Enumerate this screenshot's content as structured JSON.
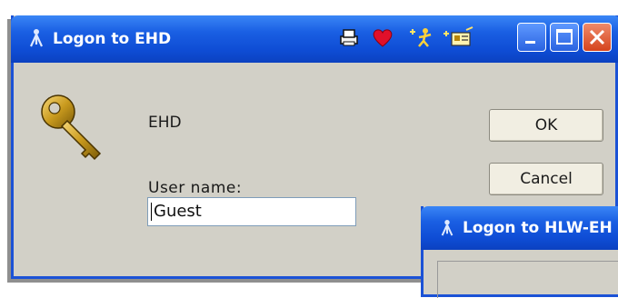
{
  "main_window": {
    "title": "Logon to EHD",
    "app_name": "EHD",
    "user_name_label": "User name:",
    "user_name_value": "Guest",
    "ok_label": "OK",
    "cancel_label": "Cancel",
    "toolbar_icons": [
      "printer-icon",
      "heart-icon",
      "person-sparkle-icon",
      "card-sparkle-icon"
    ],
    "window_buttons": [
      "minimize-icon",
      "maximize-icon",
      "close-icon"
    ]
  },
  "second_window": {
    "title": "Logon to HLW-EH"
  },
  "colors": {
    "titlebar": "#0e4cd4",
    "window_bg": "#d2d0c7",
    "close_button": "#d5431c"
  }
}
